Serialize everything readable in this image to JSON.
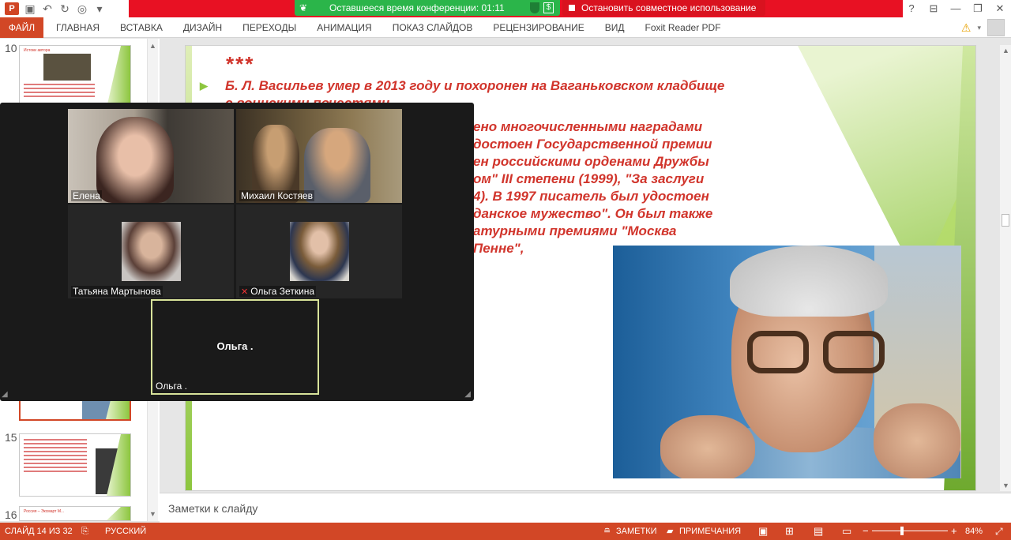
{
  "titlebar": {
    "app_logo": "P",
    "conference_timer": "Оставшееся время конференции: 01:11",
    "stop_share": "Остановить совместное использование",
    "help": "?",
    "dollar": "$"
  },
  "ribbon": {
    "file_tab": "ФАЙЛ",
    "tabs": [
      "ГЛАВНАЯ",
      "ВСТАВКА",
      "ДИЗАЙН",
      "ПЕРЕХОДЫ",
      "АНИМАЦИЯ",
      "ПОКАЗ СЛАЙДОВ",
      "РЕЦЕНЗИРОВАНИЕ",
      "ВИД",
      "Foxit Reader PDF"
    ]
  },
  "thumbnails": {
    "items": [
      {
        "number": "10",
        "title": "Истоки автора"
      },
      {
        "number": "15",
        "title": ""
      },
      {
        "number": "16",
        "title": "Россия – Эксмарт М..."
      }
    ]
  },
  "slide": {
    "stars": "***",
    "paragraph1": "Б. Л. Васильев умер в 2013 году и похоронен на Ваганьковском кладбище с воинскими почестями",
    "paragraph2_visible_lines": [
      "ено многочисленными наградами",
      "достоен Государственной премии",
      "ен российскими орденами Дружбы",
      "ом\" III степени (1999), \"За заслуги",
      "4). В 1997 писатель был удостоен",
      "данское мужество\". Он был также",
      "атурными премиями \"Москва Пенне\","
    ]
  },
  "zoom": {
    "participants": [
      {
        "name": "Елена"
      },
      {
        "name": "Михаил Костяев"
      },
      {
        "name": "Татьяна Мартынова"
      },
      {
        "name": "Ольга Зеткина",
        "muted": true
      },
      {
        "name": "Ольга ."
      }
    ],
    "active_center_name": "Ольга ."
  },
  "notes": {
    "placeholder": "Заметки к слайду"
  },
  "statusbar": {
    "slide_counter": "СЛАЙД 14 ИЗ 32",
    "language": "РУССКИЙ",
    "notes_label": "ЗАМЕТКИ",
    "comments_label": "ПРИМЕЧАНИЯ",
    "zoom_level": "84%",
    "zoom_minus": "−",
    "zoom_plus": "+"
  },
  "colors": {
    "ppt_accent": "#d24726",
    "conference_banner": "#e81123",
    "timer_green": "#2bb54a",
    "slide_text": "#d1352c",
    "slide_green": "#8dc63f"
  }
}
